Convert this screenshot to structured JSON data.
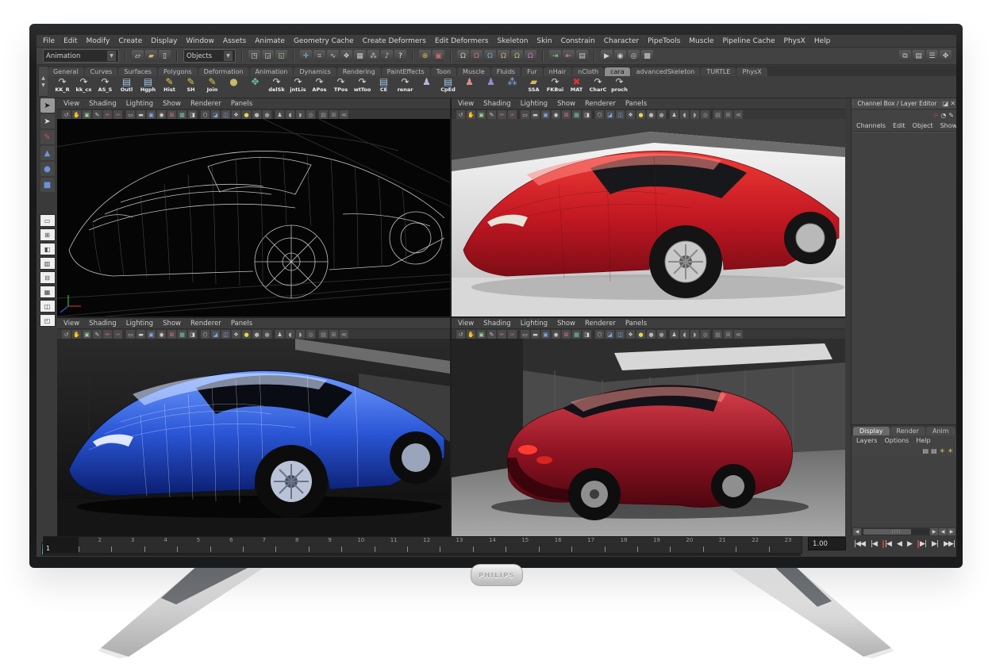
{
  "monitor": {
    "brand": "PHILIPS"
  },
  "menu_bar": {
    "items": [
      {
        "label": "File"
      },
      {
        "label": "Edit"
      },
      {
        "label": "Modify"
      },
      {
        "label": "Create"
      },
      {
        "label": "Display"
      },
      {
        "label": "Window"
      },
      {
        "label": "Assets"
      },
      {
        "label": "Animate"
      },
      {
        "label": "Geometry Cache"
      },
      {
        "label": "Create Deformers"
      },
      {
        "label": "Edit Deformers"
      },
      {
        "label": "Skeleton"
      },
      {
        "label": "Skin"
      },
      {
        "label": "Constrain"
      },
      {
        "label": "Character"
      },
      {
        "label": "PipeTools"
      },
      {
        "label": "Muscle"
      },
      {
        "label": "Pipeline Cache"
      },
      {
        "label": "PhysX"
      },
      {
        "label": "Help"
      }
    ]
  },
  "status_line": {
    "mode_selector": "Animation",
    "mask_selector": "Objects",
    "file_icons": [
      {
        "g": "▱",
        "c": "#e8e8e8"
      },
      {
        "g": "▰",
        "c": "#d8b860"
      },
      {
        "g": "▯",
        "c": "#cfe0f0"
      }
    ],
    "group_selection": [
      {
        "g": "◳",
        "c": "#d0d0d0"
      },
      {
        "g": "◲",
        "c": "#d0d0d0"
      },
      {
        "g": "◱",
        "c": "#9fd09f"
      }
    ],
    "group_masks": [
      {
        "g": "✛",
        "c": "#8fb9e8"
      },
      {
        "g": "⌗",
        "c": "#c8c8c8"
      },
      {
        "g": "∿",
        "c": "#c8c8c8"
      },
      {
        "g": "❖",
        "c": "#c8c8c8"
      },
      {
        "g": "▦",
        "c": "#c8c8c8"
      },
      {
        "g": "⁂",
        "c": "#c8c8c8"
      },
      {
        "g": "♪",
        "c": "#c8c8c8"
      },
      {
        "g": "?",
        "c": "#e8e8e8"
      }
    ],
    "group_lock": [
      {
        "g": "⊛",
        "c": "#e0c050"
      },
      {
        "g": "▣",
        "c": "#d06868"
      }
    ],
    "group_snap": [
      {
        "g": "Ω",
        "c": "#c8c8c8"
      },
      {
        "g": "Ω",
        "c": "#c87878"
      },
      {
        "g": "Ω",
        "c": "#78a8c8"
      },
      {
        "g": "Ω",
        "c": "#c8b478"
      },
      {
        "g": "Ω",
        "c": "#a8c878"
      },
      {
        "g": "Ω",
        "c": "#c878c8"
      }
    ],
    "group_history": [
      {
        "g": "⇥",
        "c": "#8fd08f"
      },
      {
        "g": "⇤",
        "c": "#d08f8f"
      },
      {
        "g": "▤",
        "c": "#c8c8c8"
      }
    ],
    "group_render": [
      {
        "g": "▶",
        "c": "#d0d0d0"
      },
      {
        "g": "◉",
        "c": "#d0d0d0"
      },
      {
        "g": "◎",
        "c": "#d0d0d0"
      },
      {
        "g": "▩",
        "c": "#d0d0d0"
      }
    ],
    "right_icons": [
      {
        "g": "⧉",
        "c": "#c8c8c8"
      },
      {
        "g": "▤",
        "c": "#c8c8c8"
      },
      {
        "g": "☰",
        "c": "#c8c8c8"
      },
      {
        "g": "✥",
        "c": "#c8c8c8"
      }
    ]
  },
  "shelf": {
    "tabs": [
      {
        "label": "General"
      },
      {
        "label": "Curves"
      },
      {
        "label": "Surfaces"
      },
      {
        "label": "Polygons"
      },
      {
        "label": "Deformation"
      },
      {
        "label": "Animation"
      },
      {
        "label": "Dynamics"
      },
      {
        "label": "Rendering"
      },
      {
        "label": "PaintEffects"
      },
      {
        "label": "Toon"
      },
      {
        "label": "Muscle"
      },
      {
        "label": "Fluids"
      },
      {
        "label": "Fur"
      },
      {
        "label": "nHair"
      },
      {
        "label": "nCloth"
      },
      {
        "label": "cara",
        "active": true
      },
      {
        "label": "advancedSkeleton"
      },
      {
        "label": "TURTLE"
      },
      {
        "label": "PhysX"
      }
    ],
    "items": [
      {
        "label": "KK_R",
        "g": "↷",
        "c": "#d8d8d8"
      },
      {
        "label": "kk_cx",
        "g": "↷",
        "c": "#d8d8d8"
      },
      {
        "label": "AS_S",
        "g": "↷",
        "c": "#d8d8d8"
      },
      {
        "label": "Outl",
        "g": "▤",
        "c": "#9ec4e8"
      },
      {
        "label": "Hgph",
        "g": "▤",
        "c": "#9ec4e8"
      },
      {
        "label": "Hist",
        "g": "✎",
        "c": "#e8c850"
      },
      {
        "label": "SH",
        "g": "✎",
        "c": "#e8c850"
      },
      {
        "label": "Join",
        "g": "✎",
        "c": "#e8c850"
      },
      {
        "label": "",
        "g": "●",
        "c": "#c8b868"
      },
      {
        "label": "",
        "g": "✥",
        "c": "#68c0b0"
      },
      {
        "label": "delSk",
        "g": "↷",
        "c": "#d8d8d8"
      },
      {
        "label": "jntLis",
        "g": "↷",
        "c": "#d8d8d8"
      },
      {
        "label": "APos",
        "g": "↷",
        "c": "#d8d8d8"
      },
      {
        "label": "TPos",
        "g": "↷",
        "c": "#d8d8d8"
      },
      {
        "label": "wtToo",
        "g": "↷",
        "c": "#d8d8d8"
      },
      {
        "label": "CE",
        "g": "▤",
        "c": "#9ec4e8"
      },
      {
        "label": "renar",
        "g": "↷",
        "c": "#d8d8d8"
      },
      {
        "label": "",
        "g": "♟",
        "c": "#b0b8d8"
      },
      {
        "label": "CpEd",
        "g": "▤",
        "c": "#9ec4e8"
      },
      {
        "label": "",
        "g": "♟",
        "c": "#d89090"
      },
      {
        "label": "",
        "g": "♟",
        "c": "#9090d8"
      },
      {
        "label": "",
        "g": "⁂",
        "c": "#7fa8e8"
      },
      {
        "label": "SSA",
        "g": "▰",
        "c": "#d8b860"
      },
      {
        "label": "FKBui",
        "g": "↷",
        "c": "#d8d8d8"
      },
      {
        "label": "MAT",
        "g": "✖",
        "c": "#e03030"
      },
      {
        "label": "CharC",
        "g": "↷",
        "c": "#d8d8d8"
      },
      {
        "label": "proch",
        "g": "↷",
        "c": "#d8d8d8"
      }
    ]
  },
  "toolbox": {
    "tools": [
      {
        "name": "select",
        "g": "➤",
        "c": "#181818",
        "active": true
      },
      {
        "name": "lasso",
        "g": "➤",
        "c": "#dddddd"
      },
      {
        "name": "paint-select",
        "g": "✎",
        "c": "#d05050"
      },
      {
        "name": "move",
        "g": "▲",
        "c": "#6b94d8"
      },
      {
        "name": "rotate",
        "g": "●",
        "c": "#6b94d8"
      },
      {
        "name": "scale",
        "g": "■",
        "c": "#6b94d8"
      }
    ],
    "layouts": [
      {
        "g": "▭"
      },
      {
        "g": "⊞"
      },
      {
        "g": "◧"
      },
      {
        "g": "▥"
      },
      {
        "g": "⊟"
      },
      {
        "g": "▦"
      },
      {
        "g": "◫"
      },
      {
        "g": "◰"
      }
    ]
  },
  "viewports": {
    "menu_items": [
      {
        "label": "View"
      },
      {
        "label": "Shading"
      },
      {
        "label": "Lighting"
      },
      {
        "label": "Show"
      },
      {
        "label": "Renderer"
      },
      {
        "label": "Panels"
      }
    ],
    "toolbar_icons": [
      {
        "g": "↺",
        "c": "#c8a8a8"
      },
      {
        "g": "✋",
        "c": "#c8c8c8"
      },
      {
        "g": "▣",
        "c": "#9fd09f"
      },
      {
        "g": "✎",
        "c": "#c8c8c8"
      },
      {
        "g": "✏",
        "c": "#d07070"
      },
      {
        "g": "✑",
        "c": "#d07070"
      },
      {
        "sep": true
      },
      {
        "g": "▭",
        "c": "#c8c8c8"
      },
      {
        "g": "▬",
        "c": "#c8c8c8"
      },
      {
        "g": "▣",
        "c": "#7fa8e8"
      },
      {
        "g": "◉",
        "c": "#d8d8d8"
      },
      {
        "g": "⊠",
        "c": "#d07070"
      },
      {
        "g": "▦",
        "c": "#6fc0b0"
      },
      {
        "g": "◨",
        "c": "#d8d8d8"
      },
      {
        "sep": true
      },
      {
        "g": "⬡",
        "c": "#c8c8c8"
      },
      {
        "g": "◪",
        "c": "#7fa8e8"
      },
      {
        "g": "◫",
        "c": "#7fa8e8"
      },
      {
        "g": "❖",
        "c": "#c8c8c8"
      },
      {
        "g": "●",
        "c": "#e8d44f"
      },
      {
        "g": "●",
        "c": "#b8b8b8"
      },
      {
        "g": "●",
        "c": "#989898"
      },
      {
        "sep": true
      },
      {
        "g": "♟",
        "c": "#c8c8c8"
      },
      {
        "g": "◖",
        "c": "#b8b8b8"
      },
      {
        "g": "◗",
        "c": "#a8a8a8"
      },
      {
        "g": "◍",
        "c": "#888888"
      },
      {
        "sep": true
      },
      {
        "g": "▤",
        "c": "#9a9a9a"
      },
      {
        "g": "⊞",
        "c": "#9a9a9a"
      },
      {
        "g": "≪",
        "c": "#88a890"
      }
    ]
  },
  "channel_box": {
    "title": "Channel Box / Layer Editor",
    "head_icons": [
      {
        "g": "◪",
        "c": "#c8c8c8"
      },
      {
        "g": "✕",
        "c": "#c8c8c8"
      }
    ],
    "row2_icons": [
      {
        "g": "⊹",
        "c": "#d05050"
      },
      {
        "g": "◔",
        "c": "#d0d0d0"
      },
      {
        "g": "✎",
        "c": "#d0d0d0"
      }
    ],
    "menus": [
      {
        "label": "Channels"
      },
      {
        "label": "Edit"
      },
      {
        "label": "Object"
      },
      {
        "label": "Show"
      }
    ]
  },
  "layer_editor": {
    "tabs": [
      {
        "label": "Display",
        "active": true
      },
      {
        "label": "Render"
      },
      {
        "label": "Anim"
      }
    ],
    "menus": [
      {
        "label": "Layers"
      },
      {
        "label": "Options"
      },
      {
        "label": "Help"
      }
    ],
    "icons": [
      {
        "g": "▤",
        "c": "#c8c8c8"
      },
      {
        "g": "▤",
        "c": "#c8c8c8"
      },
      {
        "g": "☀",
        "c": "#e0c050"
      },
      {
        "g": "☀",
        "c": "#e0c050"
      }
    ]
  },
  "timeline": {
    "current_frame": "1",
    "frames": [
      "2",
      "3",
      "4",
      "5",
      "6",
      "7",
      "8",
      "9",
      "10",
      "11",
      "12",
      "13",
      "14",
      "15",
      "16",
      "17",
      "18",
      "19",
      "20",
      "21",
      "22",
      "23"
    ],
    "rate": "1.00",
    "playback": [
      {
        "g": "|◀◀"
      },
      {
        "g": "|◀"
      },
      {
        "g": "|◀",
        "red": true
      },
      {
        "g": "◀"
      },
      {
        "g": "▶"
      },
      {
        "g": "▶|",
        "red": true
      },
      {
        "g": "▶|"
      },
      {
        "g": "▶▶|"
      }
    ]
  }
}
